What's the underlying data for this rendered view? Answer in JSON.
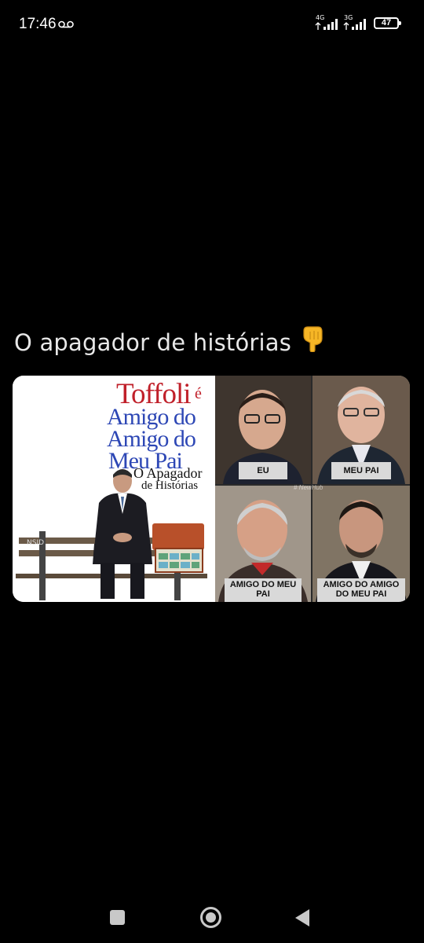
{
  "status_bar": {
    "time": "17:46",
    "network_1": "4G",
    "network_2": "3G",
    "battery": "47",
    "icons": [
      "voicemail-icon",
      "signal-icon",
      "signal-icon",
      "battery-icon"
    ]
  },
  "post": {
    "caption": "O apagador de histórias",
    "caption_emoji": "backhand-index-pointing-down-icon",
    "image_left": {
      "title_line": "Toffoli",
      "title_connector": "é",
      "line_2": "Amigo do",
      "line_3": "Amigo do",
      "line_4": "Meu Pai",
      "subtitle_1": "O Apagador",
      "subtitle_2": "de Histórias",
      "bench_tag": "NSID"
    },
    "image_right": {
      "watermark": "# NewHub",
      "panels": [
        {
          "label": "EU"
        },
        {
          "label": "MEU PAI"
        },
        {
          "label": "AMIGO DO MEU PAI"
        },
        {
          "label": "AMIGO DO AMIGO DO MEU PAI"
        }
      ]
    }
  },
  "nav_bar": {
    "recents": "recents-square-icon",
    "home": "home-circle-icon",
    "back": "back-triangle-icon"
  },
  "colors": {
    "background": "#000000",
    "title_red": "#c0202a",
    "title_blue": "#2d47b5"
  }
}
